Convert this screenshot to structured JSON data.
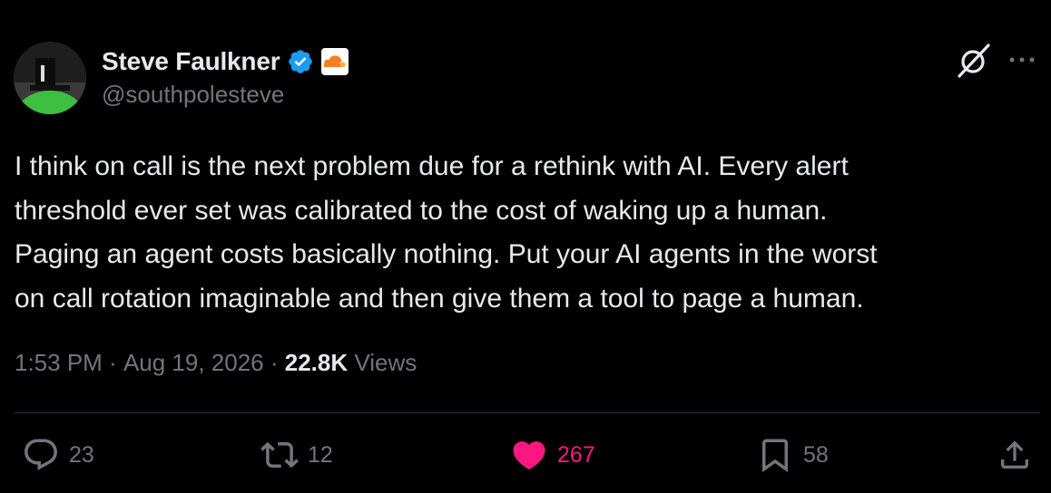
{
  "author": {
    "display_name": "Steve Faulkner",
    "handle": "@southpolesteve",
    "verified_icon": "verified-badge-icon",
    "affiliate_icon": "cloudflare-logo-icon"
  },
  "post": {
    "text": "I think on call is the next problem due for a rethink with AI. Every alert\nthreshold ever set was calibrated to the cost of waking up a human.\nPaging an agent costs  basically nothing. Put your AI agents in the worst\non call rotation imaginable and then give them a tool to page a human.",
    "time": "1:53 PM",
    "separator": " · ",
    "date": "Aug 19, 2026",
    "views_count": "22.8K",
    "views_label": " Views"
  },
  "actions": {
    "replies": "23",
    "reposts": "12",
    "likes": "267",
    "bookmarks": "58"
  },
  "colors": {
    "background": "#000000",
    "text": "#e7e9ea",
    "muted": "#71767b",
    "like": "#f91880",
    "verified": "#1d9bf0",
    "divider": "#2f3336"
  }
}
